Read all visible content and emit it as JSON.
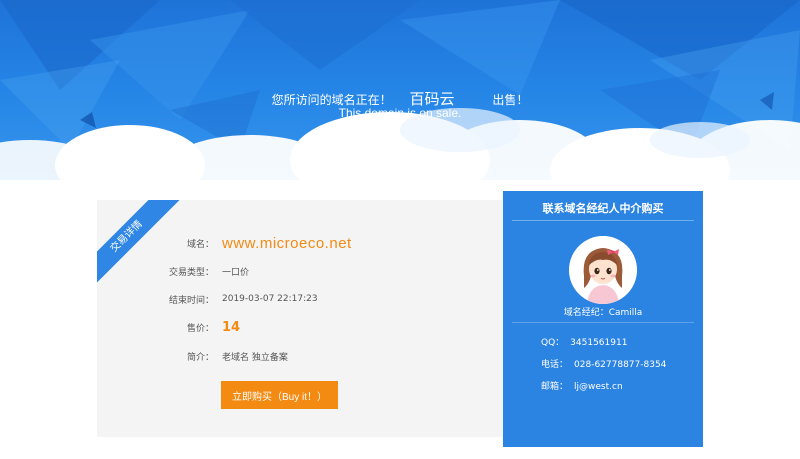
{
  "hero": {
    "notice_prefix": "您所访问的域名正在！",
    "brand": "百码云",
    "notice_suffix": "出售！",
    "english": "This domain is on sale."
  },
  "detail": {
    "ribbon": "交易详情",
    "rows": [
      {
        "label": "域名：",
        "value": "www.microeco.net"
      },
      {
        "label": "交易类型：",
        "value": "一口价"
      },
      {
        "label": "结束时间：",
        "value": "2019-03-07 22:17:23"
      },
      {
        "label": "售价：",
        "value": "14"
      },
      {
        "label": "简介：",
        "value": "老域名 独立备案"
      }
    ],
    "buy_button": "立即购买（Buy it！）"
  },
  "broker": {
    "title": "联系域名经纪人中介购买",
    "agent": "域名经纪：Camilla",
    "qq_label": "QQ：",
    "qq": "3451561911",
    "phone_label": "电话：",
    "phone": "028-62778877-8354",
    "email_label": "邮箱：",
    "email": "lj@west.cn"
  },
  "colors": {
    "hero_blue": "#2585e6",
    "accent_orange": "#f38a12",
    "panel_blue": "#2b83e2",
    "card_gray": "#f4f4f4"
  }
}
